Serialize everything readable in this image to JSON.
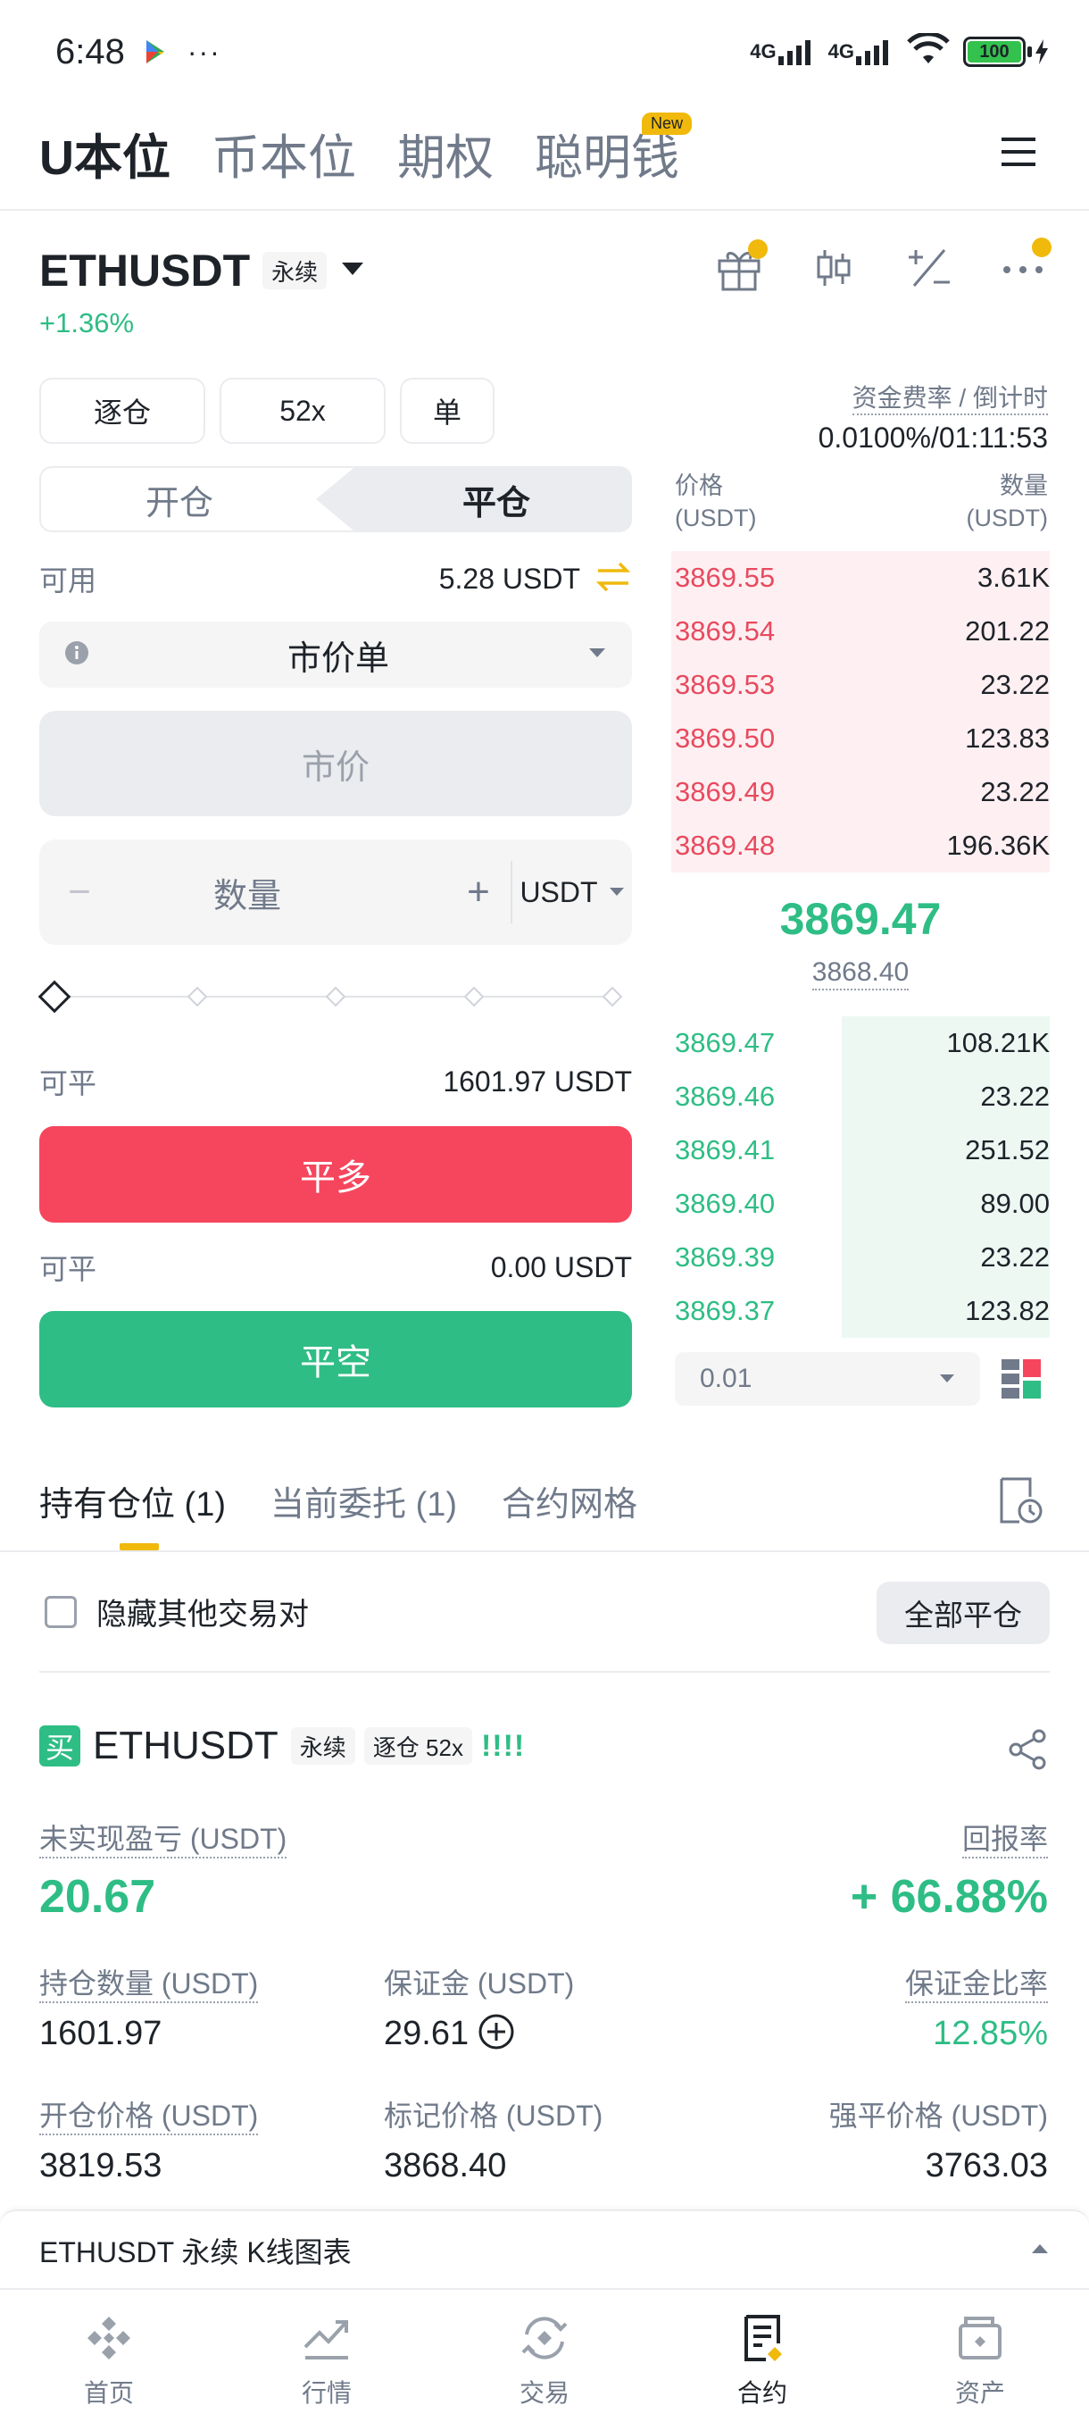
{
  "status_bar": {
    "time": "6:48",
    "more": "···",
    "network1": "4G",
    "network2": "4G",
    "battery": "100"
  },
  "top_tabs": {
    "items": [
      "U本位",
      "币本位",
      "期权",
      "聪明钱"
    ],
    "new_badge": "New"
  },
  "symbol": {
    "name": "ETHUSDT",
    "type": "永续",
    "change": "+1.36%"
  },
  "trade": {
    "margin_mode": "逐仓",
    "leverage": "52x",
    "position_mode": "单",
    "tab_open": "开仓",
    "tab_close": "平仓",
    "available_label": "可用",
    "available_value": "5.28 USDT",
    "order_type": "市价单",
    "price_placeholder": "市价",
    "qty_placeholder": "数量",
    "qty_minus": "−",
    "qty_plus": "+",
    "qty_unit": "USDT",
    "closable_label1": "可平",
    "closable_value1": "1601.97 USDT",
    "close_long": "平多",
    "closable_label2": "可平",
    "closable_value2": "0.00 USDT",
    "close_short": "平空"
  },
  "funding": {
    "label": "资金费率 / 倒计时",
    "value": "0.0100%/01:11:53"
  },
  "orderbook": {
    "price_header": "价格",
    "price_unit": "(USDT)",
    "qty_header": "数量",
    "qty_unit": "(USDT)",
    "asks": [
      {
        "price": "3869.55",
        "qty": "3.61K",
        "depth": 1.0
      },
      {
        "price": "3869.54",
        "qty": "201.22",
        "depth": 1.0
      },
      {
        "price": "3869.53",
        "qty": "23.22",
        "depth": 1.0
      },
      {
        "price": "3869.50",
        "qty": "123.83",
        "depth": 1.0
      },
      {
        "price": "3869.49",
        "qty": "23.22",
        "depth": 1.0
      },
      {
        "price": "3869.48",
        "qty": "196.36K",
        "depth": 1.0
      }
    ],
    "last_price": "3869.47",
    "mark_price": "3868.40",
    "bids": [
      {
        "price": "3869.47",
        "qty": "108.21K",
        "depth": 0.55
      },
      {
        "price": "3869.46",
        "qty": "23.22",
        "depth": 0.55
      },
      {
        "price": "3869.41",
        "qty": "251.52",
        "depth": 0.55
      },
      {
        "price": "3869.40",
        "qty": "89.00",
        "depth": 0.55
      },
      {
        "price": "3869.39",
        "qty": "23.22",
        "depth": 0.55
      },
      {
        "price": "3869.37",
        "qty": "123.82",
        "depth": 0.55
      }
    ],
    "precision": "0.01"
  },
  "positions_tabs": {
    "items": [
      "持有仓位 (1)",
      "当前委托 (1)",
      "合约网格"
    ]
  },
  "positions_toolbar": {
    "hide_others": "隐藏其他交易对",
    "close_all": "全部平仓"
  },
  "position": {
    "side": "买",
    "symbol": "ETHUSDT",
    "type": "永续",
    "margin": "逐仓 52x",
    "bars": "!!!!",
    "pnl_label": "未实现盈亏 (USDT)",
    "pnl_value": "20.67",
    "roe_label": "回报率",
    "roe_value": "+ 66.88%",
    "size_label": "持仓数量 (USDT)",
    "size_value": "1601.97",
    "margin_label": "保证金 (USDT)",
    "margin_value": "29.61",
    "margin_ratio_label": "保证金比率",
    "margin_ratio_value": "12.85%",
    "entry_label": "开仓价格 (USDT)",
    "entry_value": "3819.53",
    "mark_label": "标记价格 (USDT)",
    "mark_value": "3868.40",
    "liq_label": "强平价格 (USDT)",
    "liq_value": "3763.03"
  },
  "kline_bar": {
    "label": "ETHUSDT 永续 K线图表"
  },
  "bottom_nav": {
    "items": [
      "首页",
      "行情",
      "交易",
      "合约",
      "资产"
    ]
  },
  "colors": {
    "green": "#2ebd85",
    "red": "#f6465d",
    "accent": "#f0b90b"
  }
}
